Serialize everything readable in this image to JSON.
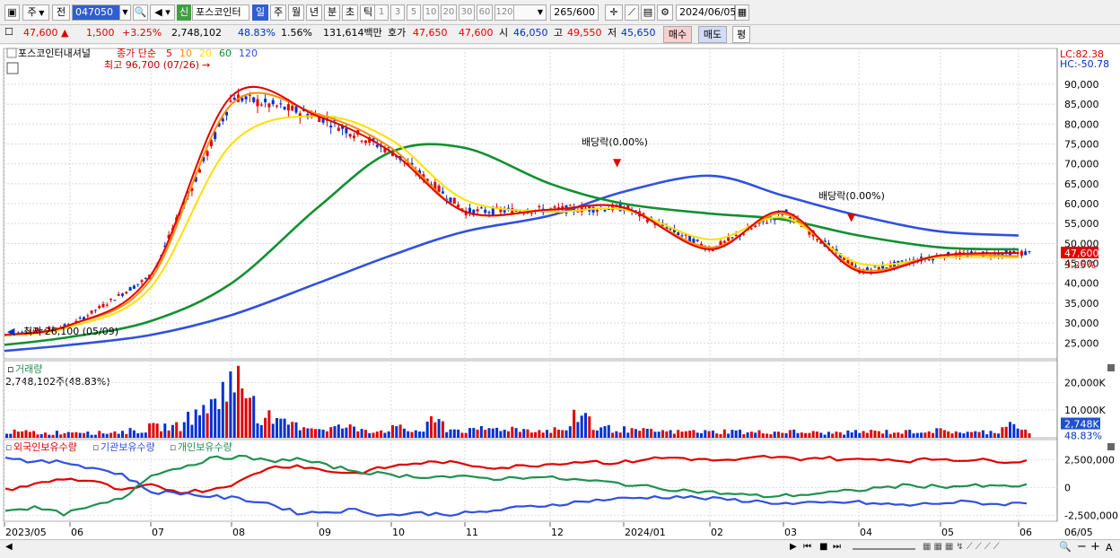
{
  "toolbar": {
    "type_label": "주",
    "market_label": "전",
    "code": "047050",
    "credit_badge": "신",
    "stock_name": "포스코인터",
    "periods": [
      "일",
      "주",
      "월",
      "년",
      "분",
      "초",
      "틱"
    ],
    "selected_period": "일",
    "intervals": [
      "1",
      "3",
      "5",
      "10",
      "20",
      "30",
      "60",
      "120"
    ],
    "count_value": "265",
    "count_total": "/600",
    "date": "2024/06/05",
    "icons": [
      "window-icon",
      "dropdown-icon",
      "search-icon",
      "speaker-icon",
      "dropdown-icon",
      "crosshair-icon",
      "draw-line-icon",
      "save-icon",
      "gear-icon",
      "calendar-icon"
    ]
  },
  "quote": {
    "price": "47,600",
    "change": "1,500",
    "change_pct": "+3.25%",
    "volume": "2,748,102",
    "volume_ratio": "48.83%",
    "turnover_pct": "1.56%",
    "trade_value": "131,614백만",
    "bid_label": "호가",
    "ask_price": "47,650",
    "bid_price": "47,600",
    "open_label": "시",
    "open": "46,050",
    "high_label": "고",
    "high": "49,550",
    "low_label": "저",
    "low": "45,650",
    "buy_button": "매수",
    "sell_button": "매도",
    "eval_button": "평"
  },
  "legend": {
    "name": "포스코인터내셔널",
    "ma_prefix": "종가 단순",
    "ma_periods": [
      "5",
      "10",
      "20",
      "60",
      "120"
    ],
    "ma_colors": [
      "#e00000",
      "#ff8c00",
      "#ffe000",
      "#109030",
      "#3050e0"
    ],
    "max_label": "최고 96,700 (07/26)",
    "min_label": "최저 26,100 (05/09)",
    "lc_label": "LC:82.38",
    "hc_label": "HC:-50.78",
    "dividend_label": "배당락(0.00%)",
    "dividend_label2": "배당락(0.00%)",
    "price_tag": "47,600",
    "pct_tag": "3.25%"
  },
  "volume_panel": {
    "title": "거래량",
    "value_label": "2,748,102주(48.83%)",
    "axis": [
      "20,000K",
      "10,000K"
    ],
    "tag": "2,748K",
    "tag_pct": "48.83%"
  },
  "flow_panel": {
    "series": [
      "외국인보유수량",
      "기관보유수량",
      "개인보유수량"
    ],
    "colors": [
      "#e00000",
      "#3050e0",
      "#209050"
    ],
    "axis": [
      "2,500,000",
      "0",
      "-2,500,000"
    ]
  },
  "xaxis": {
    "labels": [
      "2023/05",
      "06",
      "07",
      "08",
      "09",
      "10",
      "11",
      "12",
      "2024/01",
      "02",
      "03",
      "04",
      "05",
      "06",
      "06/05"
    ]
  },
  "chart_data": {
    "type": "line",
    "title": "포스코인터내셔널",
    "ylim": [
      21000,
      99000
    ],
    "yticks": [
      25000,
      30000,
      35000,
      40000,
      45000,
      50000,
      55000,
      60000,
      65000,
      70000,
      75000,
      80000,
      85000,
      90000
    ],
    "ytick_labels": [
      "25,000",
      "30,000",
      "35,000",
      "40,000",
      "45,000",
      "50,000",
      "55,000",
      "60,000",
      "65,000",
      "70,000",
      "75,000",
      "80,000",
      "85,000",
      "90,000"
    ],
    "x": [
      "2023/05",
      "06",
      "07",
      "08",
      "09",
      "10",
      "11",
      "12",
      "2024/01",
      "02",
      "03",
      "04",
      "05",
      "06"
    ],
    "series": [
      {
        "name": "5",
        "values": [
          27000,
          29500,
          42000,
          87000,
          82000,
          73000,
          58000,
          58500,
          59000,
          48500,
          58000,
          43000,
          47000,
          47600
        ]
      },
      {
        "name": "10",
        "values": [
          27000,
          29500,
          41000,
          85000,
          82500,
          74000,
          58000,
          58500,
          59000,
          49000,
          57500,
          43500,
          47000,
          46800
        ]
      },
      {
        "name": "20",
        "values": [
          26800,
          29000,
          39000,
          75000,
          82000,
          76000,
          61000,
          58000,
          58500,
          51000,
          56500,
          45000,
          46500,
          46500
        ]
      },
      {
        "name": "60",
        "values": [
          24500,
          26500,
          30500,
          40000,
          59000,
          73000,
          74000,
          65000,
          60000,
          57500,
          56000,
          52000,
          49000,
          48500
        ]
      },
      {
        "name": "120",
        "values": [
          23000,
          24500,
          27000,
          32000,
          40000,
          47000,
          53000,
          57000,
          63000,
          67000,
          62000,
          57000,
          53000,
          52000
        ]
      }
    ],
    "volume_values_k": [
      2500,
      2400,
      1900,
      2300,
      2800,
      2100,
      2500,
      3000,
      4500,
      4800,
      9000,
      14000,
      24000,
      19000,
      9000,
      6000,
      5000,
      4000,
      4500,
      3800,
      3000,
      4000,
      3000,
      6500,
      3500,
      3000,
      3800,
      4000,
      3500,
      3000,
      3500,
      9500,
      4000,
      3500,
      3000,
      2800,
      2500,
      2700,
      2500,
      2800,
      2200,
      2400,
      2600,
      2300,
      2000,
      2200,
      2500,
      2600,
      2400,
      2800,
      3000,
      2700,
      2200,
      2500,
      6000,
      2748
    ],
    "flow": {
      "foreign": [
        -200,
        300,
        800,
        600,
        -300,
        200,
        -400,
        -200,
        500,
        1800,
        2000,
        1500,
        1300,
        1800,
        2200,
        2300,
        2000,
        1800,
        2000,
        2200,
        2400,
        2200,
        2600,
        2700,
        2500,
        2400,
        2800,
        2600,
        2700,
        2500,
        2600,
        2400,
        2600,
        2500,
        2400,
        2400
      ],
      "institution": [
        2800,
        2300,
        2300,
        1800,
        1200,
        -400,
        -500,
        -800,
        -1000,
        -1400,
        -2300,
        -2200,
        -2000,
        -2500,
        -2300,
        -2400,
        -2300,
        -2000,
        -1700,
        -1500,
        -1200,
        -1000,
        -900,
        -800,
        -1000,
        -1100,
        -1300,
        -1500,
        -1400,
        -1300,
        -1500,
        -1600,
        -1400,
        -1300,
        -1500,
        -1400
      ],
      "individual": [
        -2000,
        -1800,
        -2400,
        -1700,
        -1000,
        1200,
        1800,
        2600,
        2800,
        2400,
        2600,
        2000,
        1500,
        1200,
        1000,
        1000,
        900,
        800,
        1000,
        800,
        600,
        400,
        100,
        -200,
        -400,
        -600,
        -800,
        -700,
        -500,
        -300,
        0,
        200,
        100,
        150,
        100,
        200
      ]
    }
  }
}
